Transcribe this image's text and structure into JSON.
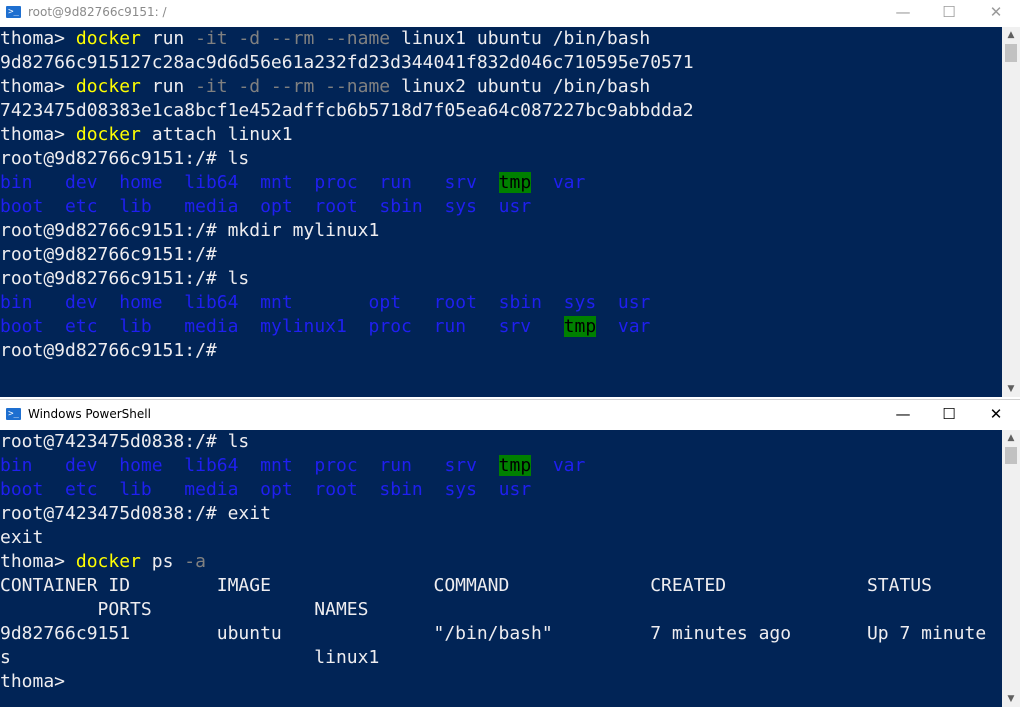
{
  "win1": {
    "title": "root@9d82766c9151: /",
    "icon": "powershell-icon",
    "controls": {
      "minimize": "—",
      "maximize": "☐",
      "close": "✕"
    },
    "lines": [
      [
        {
          "t": "thoma> ",
          "c": "n"
        },
        {
          "t": "docker",
          "c": "y"
        },
        {
          "t": " run ",
          "c": "n"
        },
        {
          "t": "-it -d --rm --name",
          "c": "g"
        },
        {
          "t": " linux1 ubuntu /bin/bash",
          "c": "n"
        }
      ],
      [
        {
          "t": "9d82766c915127c28ac9d6d56e61a232fd23d344041f832d046c710595e70571",
          "c": "n"
        }
      ],
      [
        {
          "t": "thoma> ",
          "c": "n"
        },
        {
          "t": "docker",
          "c": "y"
        },
        {
          "t": " run ",
          "c": "n"
        },
        {
          "t": "-it -d --rm --name",
          "c": "g"
        },
        {
          "t": " linux2 ubuntu /bin/bash",
          "c": "n"
        }
      ],
      [
        {
          "t": "7423475d08383e1ca8bcf1e452adffcb6b5718d7f05ea64c087227bc9abbdda2",
          "c": "n"
        }
      ],
      [
        {
          "t": "thoma> ",
          "c": "n"
        },
        {
          "t": "docker",
          "c": "y"
        },
        {
          "t": " attach linux1",
          "c": "n"
        }
      ],
      [
        {
          "t": "root@9d82766c9151:/# ls",
          "c": "n"
        }
      ],
      [
        {
          "t": "bin",
          "c": "b"
        },
        {
          "t": "   ",
          "c": "n"
        },
        {
          "t": "dev",
          "c": "b"
        },
        {
          "t": "  ",
          "c": "n"
        },
        {
          "t": "home",
          "c": "b"
        },
        {
          "t": "  ",
          "c": "n"
        },
        {
          "t": "lib64",
          "c": "b"
        },
        {
          "t": "  ",
          "c": "n"
        },
        {
          "t": "mnt",
          "c": "b"
        },
        {
          "t": "  ",
          "c": "n"
        },
        {
          "t": "proc",
          "c": "b"
        },
        {
          "t": "  ",
          "c": "n"
        },
        {
          "t": "run",
          "c": "b"
        },
        {
          "t": "   ",
          "c": "n"
        },
        {
          "t": "srv",
          "c": "b"
        },
        {
          "t": "  ",
          "c": "n"
        },
        {
          "t": "tmp",
          "c": "t"
        },
        {
          "t": "  ",
          "c": "n"
        },
        {
          "t": "var",
          "c": "b"
        }
      ],
      [
        {
          "t": "boot",
          "c": "b"
        },
        {
          "t": "  ",
          "c": "n"
        },
        {
          "t": "etc",
          "c": "b"
        },
        {
          "t": "  ",
          "c": "n"
        },
        {
          "t": "lib",
          "c": "b"
        },
        {
          "t": "   ",
          "c": "n"
        },
        {
          "t": "media",
          "c": "b"
        },
        {
          "t": "  ",
          "c": "n"
        },
        {
          "t": "opt",
          "c": "b"
        },
        {
          "t": "  ",
          "c": "n"
        },
        {
          "t": "root",
          "c": "b"
        },
        {
          "t": "  ",
          "c": "n"
        },
        {
          "t": "sbin",
          "c": "b"
        },
        {
          "t": "  ",
          "c": "n"
        },
        {
          "t": "sys",
          "c": "b"
        },
        {
          "t": "  ",
          "c": "n"
        },
        {
          "t": "usr",
          "c": "b"
        }
      ],
      [
        {
          "t": "root@9d82766c9151:/# mkdir mylinux1",
          "c": "n"
        }
      ],
      [
        {
          "t": "root@9d82766c9151:/#",
          "c": "n"
        }
      ],
      [
        {
          "t": "root@9d82766c9151:/# ls",
          "c": "n"
        }
      ],
      [
        {
          "t": "bin",
          "c": "b"
        },
        {
          "t": "   ",
          "c": "n"
        },
        {
          "t": "dev",
          "c": "b"
        },
        {
          "t": "  ",
          "c": "n"
        },
        {
          "t": "home",
          "c": "b"
        },
        {
          "t": "  ",
          "c": "n"
        },
        {
          "t": "lib64",
          "c": "b"
        },
        {
          "t": "  ",
          "c": "n"
        },
        {
          "t": "mnt",
          "c": "b"
        },
        {
          "t": "       ",
          "c": "n"
        },
        {
          "t": "opt",
          "c": "b"
        },
        {
          "t": "   ",
          "c": "n"
        },
        {
          "t": "root",
          "c": "b"
        },
        {
          "t": "  ",
          "c": "n"
        },
        {
          "t": "sbin",
          "c": "b"
        },
        {
          "t": "  ",
          "c": "n"
        },
        {
          "t": "sys",
          "c": "b"
        },
        {
          "t": "  ",
          "c": "n"
        },
        {
          "t": "usr",
          "c": "b"
        }
      ],
      [
        {
          "t": "boot",
          "c": "b"
        },
        {
          "t": "  ",
          "c": "n"
        },
        {
          "t": "etc",
          "c": "b"
        },
        {
          "t": "  ",
          "c": "n"
        },
        {
          "t": "lib",
          "c": "b"
        },
        {
          "t": "   ",
          "c": "n"
        },
        {
          "t": "media",
          "c": "b"
        },
        {
          "t": "  ",
          "c": "n"
        },
        {
          "t": "mylinux1",
          "c": "b"
        },
        {
          "t": "  ",
          "c": "n"
        },
        {
          "t": "proc",
          "c": "b"
        },
        {
          "t": "  ",
          "c": "n"
        },
        {
          "t": "run",
          "c": "b"
        },
        {
          "t": "   ",
          "c": "n"
        },
        {
          "t": "srv",
          "c": "b"
        },
        {
          "t": "   ",
          "c": "n"
        },
        {
          "t": "tmp",
          "c": "t"
        },
        {
          "t": "  ",
          "c": "n"
        },
        {
          "t": "var",
          "c": "b"
        }
      ],
      [
        {
          "t": "root@9d82766c9151:/#",
          "c": "n"
        }
      ]
    ]
  },
  "win2": {
    "title": "Windows PowerShell",
    "icon": "powershell-icon",
    "controls": {
      "minimize": "—",
      "maximize": "☐",
      "close": "✕"
    },
    "lines": [
      [
        {
          "t": "root@7423475d0838:/# ls",
          "c": "n"
        }
      ],
      [
        {
          "t": "bin",
          "c": "b"
        },
        {
          "t": "   ",
          "c": "n"
        },
        {
          "t": "dev",
          "c": "b"
        },
        {
          "t": "  ",
          "c": "n"
        },
        {
          "t": "home",
          "c": "b"
        },
        {
          "t": "  ",
          "c": "n"
        },
        {
          "t": "lib64",
          "c": "b"
        },
        {
          "t": "  ",
          "c": "n"
        },
        {
          "t": "mnt",
          "c": "b"
        },
        {
          "t": "  ",
          "c": "n"
        },
        {
          "t": "proc",
          "c": "b"
        },
        {
          "t": "  ",
          "c": "n"
        },
        {
          "t": "run",
          "c": "b"
        },
        {
          "t": "   ",
          "c": "n"
        },
        {
          "t": "srv",
          "c": "b"
        },
        {
          "t": "  ",
          "c": "n"
        },
        {
          "t": "tmp",
          "c": "t"
        },
        {
          "t": "  ",
          "c": "n"
        },
        {
          "t": "var",
          "c": "b"
        }
      ],
      [
        {
          "t": "boot",
          "c": "b"
        },
        {
          "t": "  ",
          "c": "n"
        },
        {
          "t": "etc",
          "c": "b"
        },
        {
          "t": "  ",
          "c": "n"
        },
        {
          "t": "lib",
          "c": "b"
        },
        {
          "t": "   ",
          "c": "n"
        },
        {
          "t": "media",
          "c": "b"
        },
        {
          "t": "  ",
          "c": "n"
        },
        {
          "t": "opt",
          "c": "b"
        },
        {
          "t": "  ",
          "c": "n"
        },
        {
          "t": "root",
          "c": "b"
        },
        {
          "t": "  ",
          "c": "n"
        },
        {
          "t": "sbin",
          "c": "b"
        },
        {
          "t": "  ",
          "c": "n"
        },
        {
          "t": "sys",
          "c": "b"
        },
        {
          "t": "  ",
          "c": "n"
        },
        {
          "t": "usr",
          "c": "b"
        }
      ],
      [
        {
          "t": "root@7423475d0838:/# exit",
          "c": "n"
        }
      ],
      [
        {
          "t": "exit",
          "c": "n"
        }
      ],
      [
        {
          "t": "thoma> ",
          "c": "n"
        },
        {
          "t": "docker",
          "c": "y"
        },
        {
          "t": " ps ",
          "c": "n"
        },
        {
          "t": "-a",
          "c": "g"
        }
      ],
      [
        {
          "t": "CONTAINER ID        IMAGE               COMMAND             CREATED             STATUS",
          "c": "n"
        }
      ],
      [
        {
          "t": "         PORTS               NAMES",
          "c": "n"
        }
      ],
      [
        {
          "t": "9d82766c9151        ubuntu              \"/bin/bash\"         7 minutes ago       Up 7 minute",
          "c": "n"
        }
      ],
      [
        {
          "t": "s                            linux1",
          "c": "n"
        }
      ],
      [
        {
          "t": "thoma>",
          "c": "n"
        }
      ]
    ]
  },
  "scroll_arrows": {
    "up": "▲",
    "down": "▼"
  },
  "colors": {
    "console_bg": "#012456",
    "foreground": "#eeedf0",
    "command": "#ffff00",
    "parameter": "#808080",
    "directory": "#1f1ff0",
    "tmp_highlight": "#008000"
  }
}
